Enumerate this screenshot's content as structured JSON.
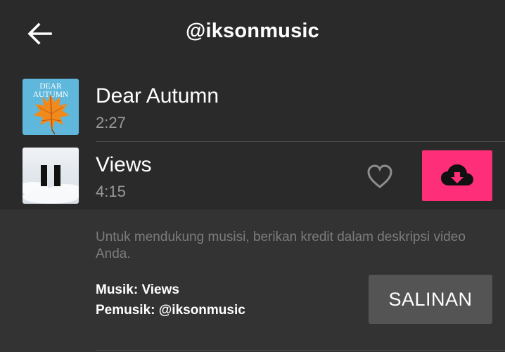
{
  "header": {
    "title": "@iksonmusic",
    "back_icon": "arrow-left-icon"
  },
  "tracks": [
    {
      "name": "Dear Autumn",
      "duration": "2:27",
      "cover_text": "DEAR AUTUMN"
    },
    {
      "name": "Views",
      "duration": "4:15",
      "state": "playing",
      "playback_icon": "pause-icon",
      "favorite_icon": "heart-outline-icon",
      "download_icon": "cloud-download-icon"
    }
  ],
  "credit": {
    "note": "Untuk mendukung musisi, berikan kredit dalam deskripsi video Anda.",
    "music_line": "Musik: Views",
    "artist_line": "Pemusik: @iksonmusic",
    "copy_label": "SALINAN"
  },
  "colors": {
    "background": "#2a2a2a",
    "panel": "#333333",
    "accent": "#ff2e78",
    "copy_button": "#545454",
    "muted_text": "#9a9a9a"
  }
}
